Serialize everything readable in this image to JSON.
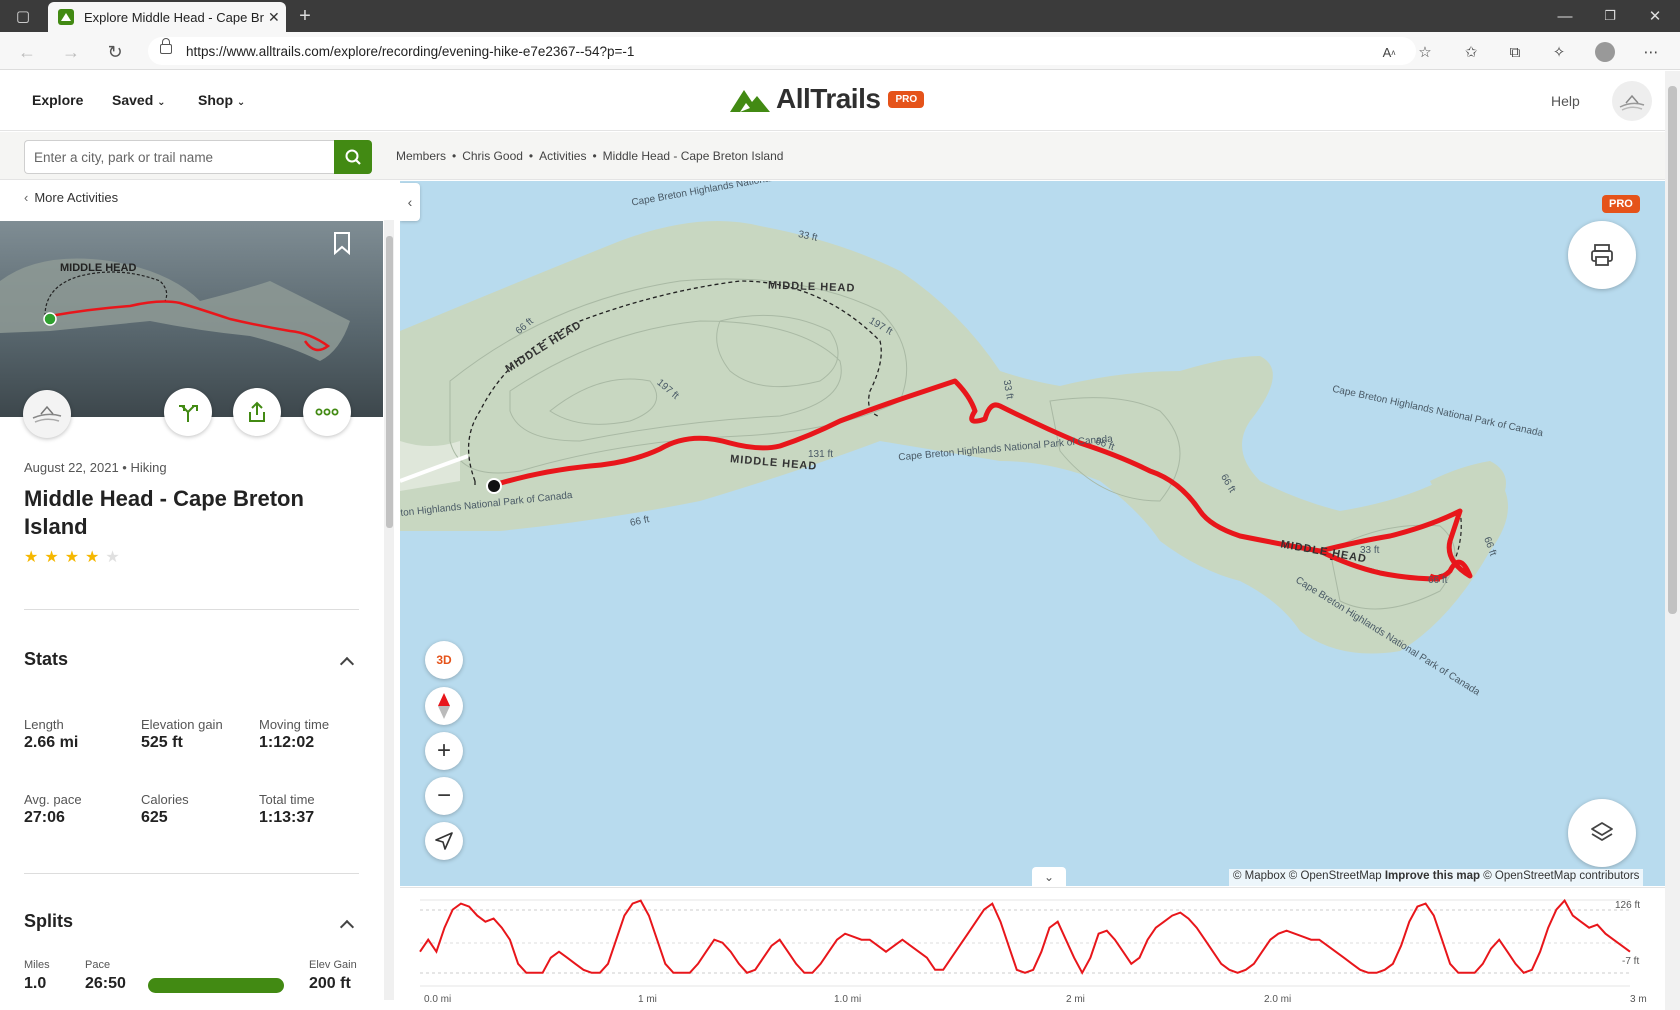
{
  "browser": {
    "tab_title": "Explore Middle Head - Cape Bret",
    "url": "https://www.alltrails.com/explore/recording/evening-hike-e7e2367--54?p=-1"
  },
  "header": {
    "nav": [
      "Explore",
      "Saved",
      "Shop"
    ],
    "logo": "AllTrails",
    "pro": "PRO",
    "help": "Help"
  },
  "search": {
    "placeholder": "Enter a city, park or trail name"
  },
  "breadcrumbs": [
    "Members",
    "Chris Good",
    "Activities",
    "Middle Head - Cape Breton Island"
  ],
  "breadcrumb_sep": "•",
  "panel": {
    "back_label": "More Activities",
    "meta": "August 22, 2021 • Hiking",
    "title": "Middle Head - Cape Breton Island",
    "rating": 4,
    "stats_title": "Stats",
    "stats": [
      {
        "label": "Length",
        "value": "2.66 mi"
      },
      {
        "label": "Elevation gain",
        "value": "525 ft"
      },
      {
        "label": "Moving time",
        "value": "1:12:02"
      },
      {
        "label": "Avg. pace",
        "value": "27:06"
      },
      {
        "label": "Calories",
        "value": "625"
      },
      {
        "label": "Total time",
        "value": "1:13:37"
      }
    ],
    "splits_title": "Splits",
    "splits_headers": [
      "Miles",
      "Pace",
      "Elev Gain"
    ],
    "splits": [
      {
        "miles": "1.0",
        "pace": "26:50",
        "elev": "200 ft"
      }
    ]
  },
  "map": {
    "pro": "PRO",
    "btn_3d": "3D",
    "labels": {
      "park_top": "Cape Breton Highlands National Park of Canada",
      "park_right": "Cape Breton Highlands National Park of Canada",
      "park_mid": "Cape Breton Highlands National Park of Canada",
      "park_bottom": "Cape Breton Highlands National Park of Canada",
      "park_left": "ton Highlands National Park of Canada",
      "trail1": "MIDDLE HEAD",
      "trail2": "MIDDLE HEAD",
      "trail3": "MIDDLE HEAD",
      "trail4": "MIDDLE HEAD",
      "c33a": "33 ft",
      "c66a": "66 ft",
      "c197a": "197 ft",
      "c197b": "197 ft",
      "c131": "131 ft",
      "c66b": "66 ft",
      "c66c": "66 ft",
      "c66d": "66 ft",
      "c33b": "33 ft",
      "c66e": "66 ft",
      "c33c": "33 ft",
      "c66f": "66 ft"
    },
    "attribution_a": "© Mapbox © OpenStreetMap",
    "attribution_b": "Improve this map",
    "attribution_c": "© OpenStreetMap contributors"
  },
  "elevation": {
    "max_label": "126 ft",
    "min_label": "-7 ft",
    "x_ticks": [
      "0.0 mi",
      "1 mi",
      "1.0 mi",
      "2 mi",
      "2.0 mi",
      "3 m"
    ],
    "profile_ft": [
      40,
      60,
      40,
      80,
      110,
      120,
      115,
      100,
      90,
      95,
      80,
      60,
      20,
      5,
      5,
      5,
      30,
      40,
      30,
      20,
      10,
      5,
      5,
      20,
      60,
      100,
      120,
      125,
      100,
      60,
      20,
      5,
      5,
      5,
      20,
      40,
      60,
      55,
      40,
      20,
      5,
      10,
      30,
      50,
      60,
      40,
      20,
      5,
      5,
      20,
      40,
      60,
      70,
      65,
      60,
      60,
      50,
      40,
      50,
      60,
      50,
      40,
      30,
      10,
      10,
      30,
      50,
      70,
      90,
      110,
      120,
      90,
      50,
      10,
      5,
      10,
      40,
      80,
      90,
      60,
      30,
      5,
      30,
      70,
      75,
      60,
      40,
      20,
      30,
      60,
      80,
      90,
      100,
      105,
      95,
      80,
      60,
      40,
      20,
      10,
      5,
      10,
      20,
      40,
      60,
      70,
      75,
      70,
      65,
      60,
      60,
      50,
      40,
      30,
      20,
      10,
      5,
      5,
      10,
      20,
      50,
      90,
      115,
      120,
      100,
      60,
      20,
      5,
      5,
      5,
      20,
      45,
      60,
      40,
      20,
      5,
      10,
      40,
      80,
      110,
      125,
      100,
      90,
      80,
      85,
      70,
      60,
      50,
      40
    ]
  },
  "colors": {
    "brand_green": "#428a13",
    "pro_orange": "#e5531a",
    "track_red": "#e8161b",
    "water": "#b8dbee",
    "land": "#c8d7c1"
  }
}
